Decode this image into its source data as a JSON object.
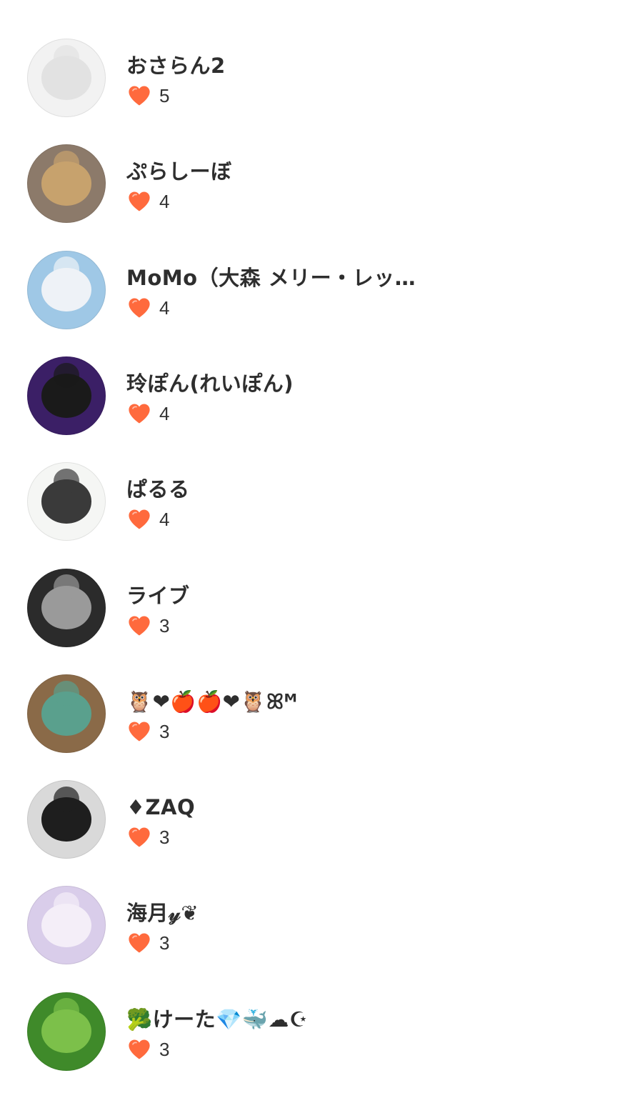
{
  "heart_color": "#ff6a3d",
  "users": [
    {
      "name": "おさらん2",
      "likes": "5",
      "avatar": {
        "icon": "plate-icon",
        "bg": "#f2f2f2",
        "fg": "#e2e2e2"
      }
    },
    {
      "name": "ぷらしーぼ",
      "likes": "4",
      "avatar": {
        "icon": "bear-plush-icon",
        "bg": "#8c7a6a",
        "fg": "#c7a26d"
      }
    },
    {
      "name": "MoMo（大森 メリー・レッ…",
      "likes": "4",
      "avatar": {
        "icon": "anime-girl-icon",
        "bg": "#9fc8e6",
        "fg": "#eef2f7"
      }
    },
    {
      "name": "玲ぽん(れいぽん)",
      "likes": "4",
      "avatar": {
        "icon": "anime-boy-icon",
        "bg": "#3b1f66",
        "fg": "#1a1a1a"
      }
    },
    {
      "name": "ぱるる",
      "likes": "4",
      "avatar": {
        "icon": "anime-girl-icon",
        "bg": "#f5f6f4",
        "fg": "#3a3a3a"
      }
    },
    {
      "name": "ライブ",
      "likes": "3",
      "avatar": {
        "icon": "motorcycle-icon",
        "bg": "#2b2b2b",
        "fg": "#9a9a9a"
      }
    },
    {
      "name": "🦉❤🍎🍎❤🦉ꕤᴹ",
      "likes": "3",
      "avatar": {
        "icon": "drinks-icon",
        "bg": "#8a6a48",
        "fg": "#5aa08d"
      }
    },
    {
      "name": "♦ZAQ",
      "likes": "3",
      "avatar": {
        "icon": "person-icon",
        "bg": "#d9d9d9",
        "fg": "#1e1e1e"
      }
    },
    {
      "name": "海月𝓎❦",
      "likes": "3",
      "avatar": {
        "icon": "anime-girl-icon",
        "bg": "#d9cdea",
        "fg": "#f4eef8"
      }
    },
    {
      "name": "🥦けーた💎🐳☁☪",
      "likes": "3",
      "avatar": {
        "icon": "broccoli-icon",
        "bg": "#3f8a2a",
        "fg": "#7cc04a"
      }
    }
  ]
}
